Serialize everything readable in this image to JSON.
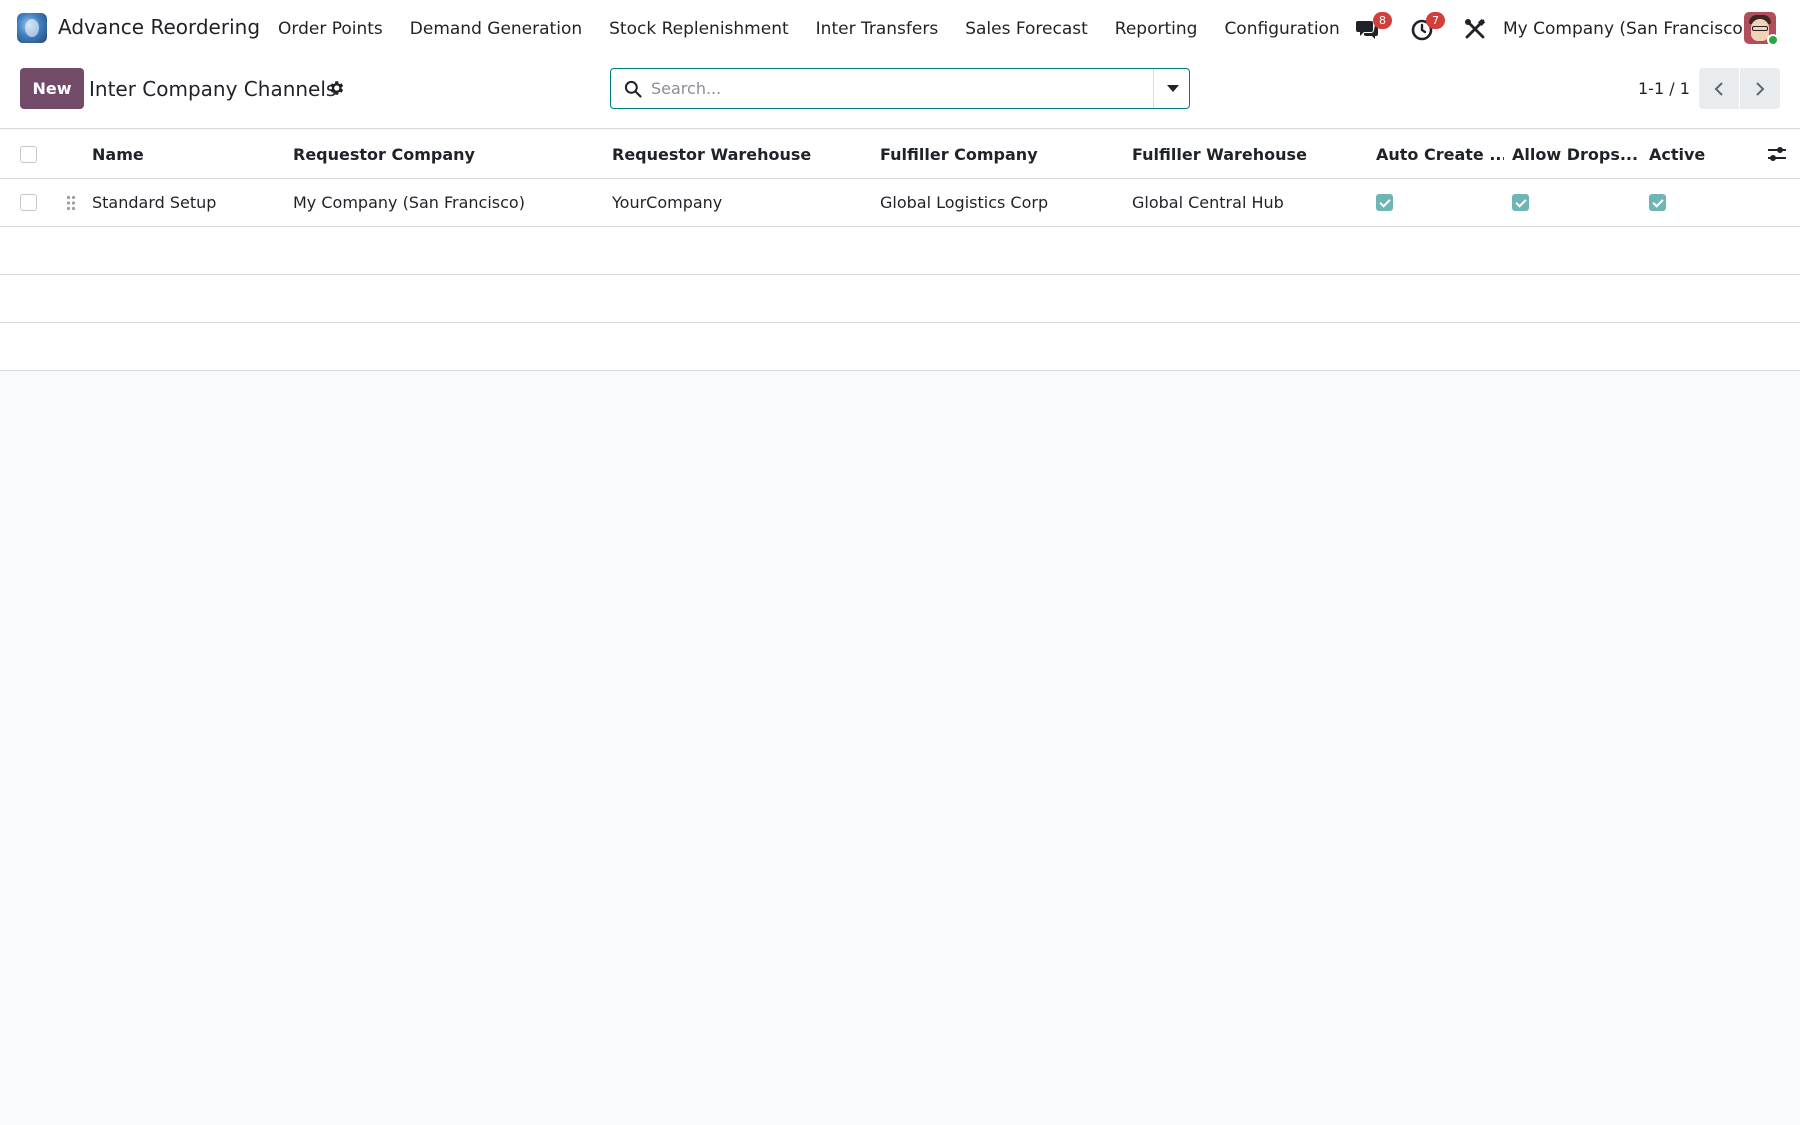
{
  "app": {
    "name": "Advance Reordering",
    "logo_icon": "app-logo-icon"
  },
  "menu": {
    "items": [
      {
        "label": "Order Points"
      },
      {
        "label": "Demand Generation"
      },
      {
        "label": "Stock Replenishment"
      },
      {
        "label": "Inter Transfers"
      },
      {
        "label": "Sales Forecast"
      },
      {
        "label": "Reporting"
      },
      {
        "label": "Configuration"
      }
    ]
  },
  "systray": {
    "messages_count": "8",
    "activities_count": "7",
    "company": "My Company (San Francisco)"
  },
  "control": {
    "new_label": "New",
    "title": "Inter Company Channels",
    "search_placeholder": "Search...",
    "pager": "1-1 / 1"
  },
  "table": {
    "columns": [
      "Name",
      "Requestor Company",
      "Requestor Warehouse",
      "Fulfiller Company",
      "Fulfiller Warehouse",
      "Auto Create ...",
      "Allow Drops...",
      "Active"
    ],
    "rows": [
      {
        "name": "Standard Setup",
        "requestor_company": "My Company (San Francisco)",
        "requestor_warehouse": "YourCompany",
        "fulfiller_company": "Global Logistics Corp",
        "fulfiller_warehouse": "Global Central Hub",
        "auto_create": true,
        "allow_dropship": true,
        "active": true
      }
    ]
  },
  "colors": {
    "primary": "#714b67",
    "accent": "#017e84",
    "checkbox_checked": "#70b5b6",
    "badge": "#d23f3a"
  }
}
